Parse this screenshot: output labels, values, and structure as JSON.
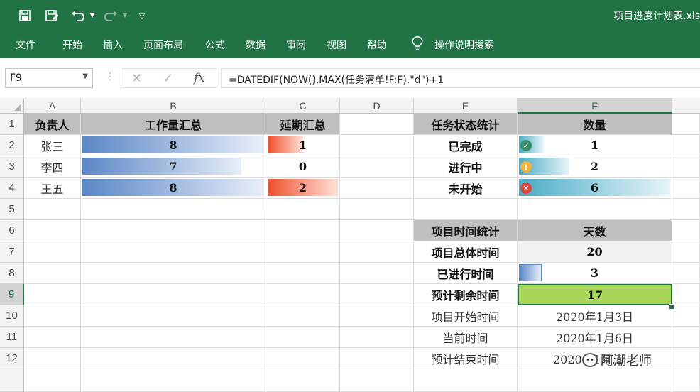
{
  "app": {
    "doc_title": "项目进度计划表.xls"
  },
  "quick_access": {
    "save_icon": "save-icon",
    "save_as_icon": "save-as-icon",
    "undo_icon": "undo-icon",
    "redo_icon": "redo-icon",
    "customize_icon": "customize-icon"
  },
  "ribbon": {
    "tabs": [
      "文件",
      "开始",
      "插入",
      "页面布局",
      "公式",
      "数据",
      "审阅",
      "视图",
      "帮助"
    ],
    "tell_me": "操作说明搜索"
  },
  "formula_bar": {
    "name_box": "F9",
    "cancel": "✕",
    "enter": "✓",
    "fx": "fx",
    "formula": "=DATEDIF(NOW(),MAX(任务清单!F:F),\"d\")+1"
  },
  "columns": [
    "A",
    "B",
    "C",
    "D",
    "E",
    "F"
  ],
  "rows": [
    "1",
    "2",
    "3",
    "4",
    "5",
    "6",
    "7",
    "8",
    "9",
    "10",
    "11",
    "12"
  ],
  "selected": {
    "column": "F",
    "row": "9"
  },
  "sheet": {
    "left_table": {
      "headers": [
        "负责人",
        "工作量汇总",
        "延期汇总"
      ],
      "rows": [
        {
          "name": "张三",
          "workload": "8",
          "delay": "1"
        },
        {
          "name": "李四",
          "workload": "7",
          "delay": "0"
        },
        {
          "name": "王五",
          "workload": "8",
          "delay": "2"
        }
      ],
      "workload_max": 8,
      "delay_max": 2
    },
    "status_table": {
      "headers": [
        "任务状态统计",
        "数量"
      ],
      "rows": [
        {
          "label": "已完成",
          "count": "1",
          "icon": "check-circle-icon"
        },
        {
          "label": "进行中",
          "count": "2",
          "icon": "warning-circle-icon"
        },
        {
          "label": "未开始",
          "count": "6",
          "icon": "error-circle-icon"
        }
      ],
      "count_max": 6
    },
    "time_table": {
      "headers": [
        "项目时间统计",
        "天数"
      ],
      "rows": [
        {
          "label": "项目总体时间",
          "value": "20"
        },
        {
          "label": "已进行时间",
          "value": "3"
        },
        {
          "label": "预计剩余时间",
          "value": "17"
        },
        {
          "label": "项目开始时间",
          "value": "2020年1月3日"
        },
        {
          "label": "当前时间",
          "value": "2020年1月6日"
        },
        {
          "label": "预计结束时间",
          "value": "2020年1月..."
        }
      ],
      "elapsed_fraction": 0.15
    }
  },
  "watermark": "阿潮老师",
  "colors": {
    "excel_green": "#217346",
    "header_gray": "#bfbfbf",
    "highlight_green": "#a9d65a",
    "bar_blue": "#5b87c5",
    "bar_red": "#f0502d",
    "bar_teal": "#4bacc6"
  }
}
